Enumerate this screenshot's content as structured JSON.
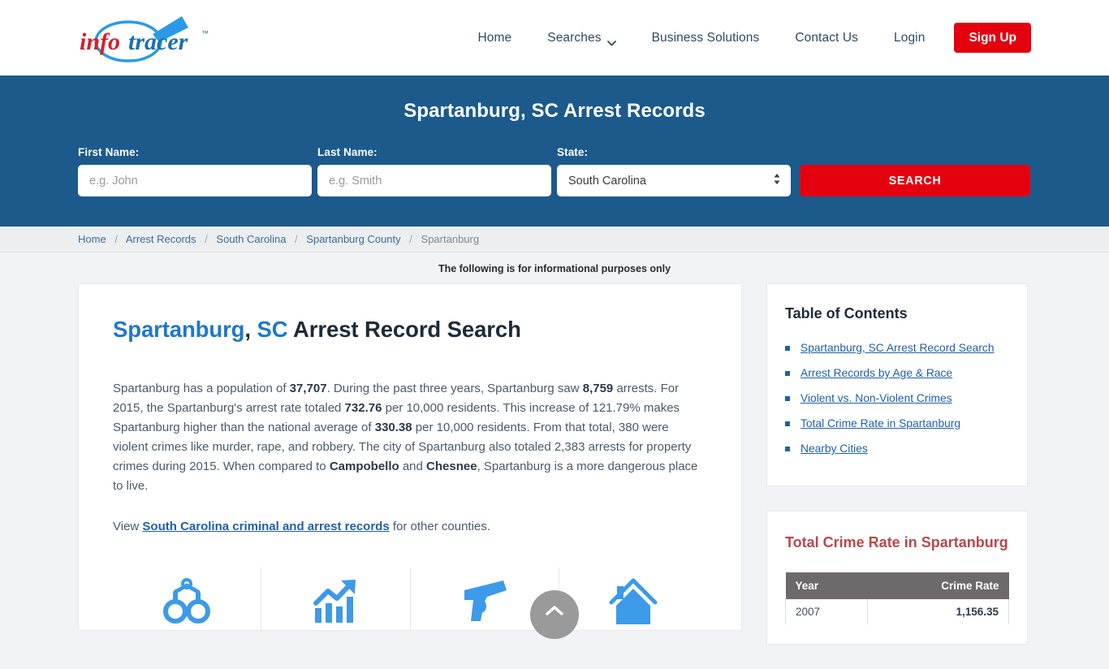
{
  "header": {
    "logo": {
      "part1": "info",
      "part2": "tracer",
      "tm": "™"
    },
    "nav": [
      {
        "label": "Home",
        "has_dropdown": false
      },
      {
        "label": "Searches",
        "has_dropdown": true
      },
      {
        "label": "Business Solutions",
        "has_dropdown": false
      },
      {
        "label": "Contact Us",
        "has_dropdown": false
      },
      {
        "label": "Login",
        "has_dropdown": false
      }
    ],
    "signup_label": "Sign Up",
    "signup_color": "#e4000f"
  },
  "hero": {
    "title": "Spartanburg, SC Arrest Records",
    "background_color": "#1c5a8c",
    "first_name": {
      "label": "First Name:",
      "placeholder": "e.g. John",
      "value": ""
    },
    "last_name": {
      "label": "Last Name:",
      "placeholder": "e.g. Smith",
      "value": ""
    },
    "state": {
      "label": "State:",
      "value": "South Carolina"
    },
    "search_label": "SEARCH"
  },
  "breadcrumb": {
    "items": [
      "Home",
      "Arrest Records",
      "South Carolina",
      "Spartanburg County",
      "Spartanburg"
    ],
    "separator": "/"
  },
  "disclaimer": "The following is for informational purposes only",
  "main": {
    "heading": {
      "city": "Spartanburg",
      "comma": ",",
      "state_abbr": "SC",
      "rest": "Arrest Record Search"
    },
    "paragraph_1": {
      "t1": "Spartanburg has a population of ",
      "b1": "37,707",
      "t2": ". During the past three years, Spartanburg saw ",
      "b2": "8,759",
      "t3": " arrests. For 2015, the Spartanburg's arrest rate totaled ",
      "b3": "732.76",
      "t4": " per 10,000 residents. This increase of 121.79% makes Spartanburg higher than the national average of ",
      "b4": "330.38",
      "t5": " per 10,000 residents. From that total, 380 were violent crimes like murder, rape, and robbery. The city of Spartanburg also totaled 2,383 arrests for property crimes during 2015. When compared to ",
      "b5": "Campobello",
      "t6": " and ",
      "b6": "Chesnee",
      "t7": ", Spartanburg is a more dangerous place to live."
    },
    "paragraph_2": {
      "t1": "View ",
      "link": "South Carolina criminal and arrest records",
      "t2": " for other counties."
    },
    "icons": [
      {
        "name": "handcuffs-icon"
      },
      {
        "name": "growth-chart-icon"
      },
      {
        "name": "handgun-icon"
      },
      {
        "name": "house-icon"
      }
    ]
  },
  "sidebar": {
    "toc": {
      "title": "Table of Contents",
      "items": [
        "Spartanburg, SC Arrest Record Search",
        "Arrest Records by Age & Race",
        "Violent vs. Non-Violent Crimes",
        "Total Crime Rate in Spartanburg",
        "Nearby Cities"
      ]
    },
    "crime_rate": {
      "title": "Total Crime Rate in Spartanburg",
      "title_color": "#b8484c",
      "columns": [
        "Year",
        "Crime Rate"
      ],
      "rows": [
        {
          "year": "2007",
          "rate": "1,156.35"
        }
      ]
    }
  },
  "scroll_top": {
    "label": "scroll-to-top"
  }
}
